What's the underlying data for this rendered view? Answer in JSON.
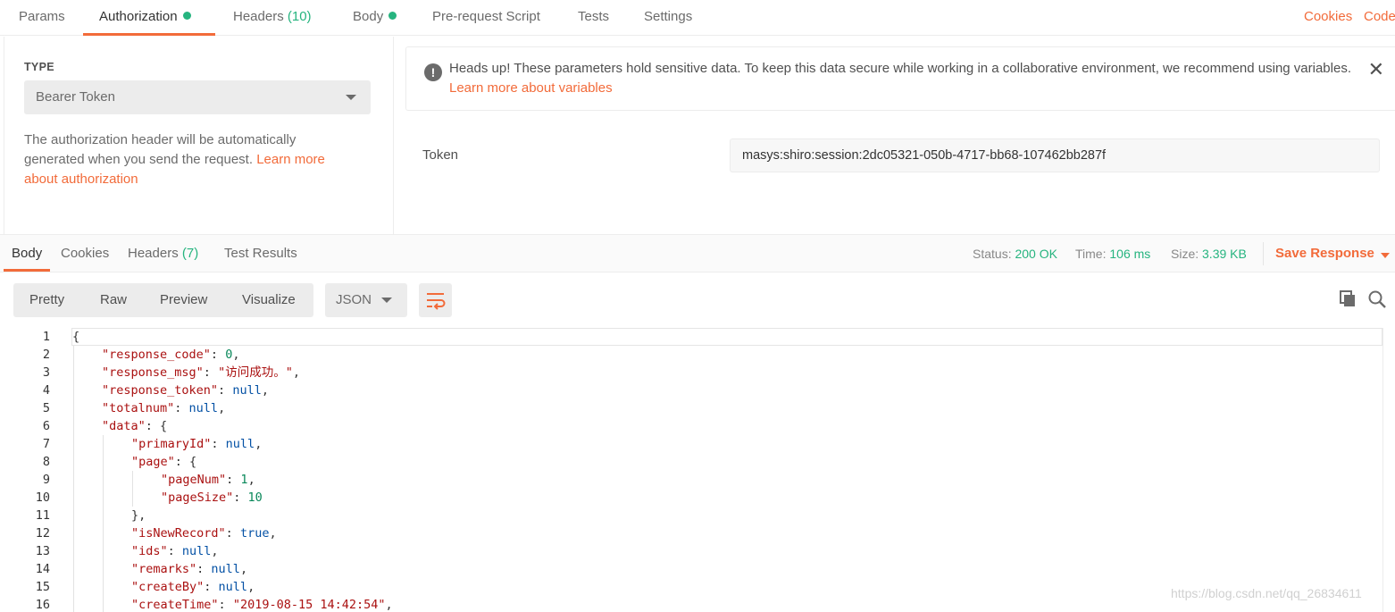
{
  "request_tabs": [
    {
      "label": "Params"
    },
    {
      "label": "Authorization"
    },
    {
      "label": "Headers",
      "count": "(10)"
    },
    {
      "label": "Body"
    },
    {
      "label": "Pre-request Script"
    },
    {
      "label": "Tests"
    },
    {
      "label": "Settings"
    }
  ],
  "right_links": {
    "cookies": "Cookies",
    "code": "Code"
  },
  "auth": {
    "type_label": "TYPE",
    "type_value": "Bearer Token",
    "desc": "The authorization header will be automatically generated when you send the request. ",
    "desc_link": "Learn more about authorization"
  },
  "alert": {
    "text": "Heads up! These parameters hold sensitive data. To keep this data secure while working in a collaborative environment, we recommend using variables. ",
    "link": "Learn more about variables",
    "close": "✕",
    "icon": "!"
  },
  "token": {
    "label": "Token",
    "value": "masys:shiro:session:2dc05321-050b-4717-bb68-107462bb287f"
  },
  "response_tabs": [
    {
      "label": "Body"
    },
    {
      "label": "Cookies"
    },
    {
      "label": "Headers",
      "count": "(7)"
    },
    {
      "label": "Test Results"
    }
  ],
  "status": {
    "status_label": "Status:",
    "status_value": "200 OK",
    "time_label": "Time:",
    "time_value": "106 ms",
    "size_label": "Size:",
    "size_value": "3.39 KB",
    "save_label": "Save Response"
  },
  "view_modes": [
    "Pretty",
    "Raw",
    "Preview",
    "Visualize"
  ],
  "format": "JSON",
  "code_lines": [
    {
      "n": "1",
      "indent": 0,
      "parts": [
        [
          "p",
          "{"
        ]
      ]
    },
    {
      "n": "2",
      "indent": 1,
      "parts": [
        [
          "k",
          "\"response_code\""
        ],
        [
          "p",
          ": "
        ],
        [
          "n",
          "0"
        ],
        [
          "p",
          ","
        ]
      ]
    },
    {
      "n": "3",
      "indent": 1,
      "parts": [
        [
          "k",
          "\"response_msg\""
        ],
        [
          "p",
          ": "
        ],
        [
          "s",
          "\"访问成功。\""
        ],
        [
          "p",
          ","
        ]
      ]
    },
    {
      "n": "4",
      "indent": 1,
      "parts": [
        [
          "k",
          "\"response_token\""
        ],
        [
          "p",
          ": "
        ],
        [
          "kw",
          "null"
        ],
        [
          "p",
          ","
        ]
      ]
    },
    {
      "n": "5",
      "indent": 1,
      "parts": [
        [
          "k",
          "\"totalnum\""
        ],
        [
          "p",
          ": "
        ],
        [
          "kw",
          "null"
        ],
        [
          "p",
          ","
        ]
      ]
    },
    {
      "n": "6",
      "indent": 1,
      "parts": [
        [
          "k",
          "\"data\""
        ],
        [
          "p",
          ": {"
        ]
      ]
    },
    {
      "n": "7",
      "indent": 2,
      "parts": [
        [
          "k",
          "\"primaryId\""
        ],
        [
          "p",
          ": "
        ],
        [
          "kw",
          "null"
        ],
        [
          "p",
          ","
        ]
      ]
    },
    {
      "n": "8",
      "indent": 2,
      "parts": [
        [
          "k",
          "\"page\""
        ],
        [
          "p",
          ": {"
        ]
      ]
    },
    {
      "n": "9",
      "indent": 3,
      "parts": [
        [
          "k",
          "\"pageNum\""
        ],
        [
          "p",
          ": "
        ],
        [
          "n",
          "1"
        ],
        [
          "p",
          ","
        ]
      ]
    },
    {
      "n": "10",
      "indent": 3,
      "parts": [
        [
          "k",
          "\"pageSize\""
        ],
        [
          "p",
          ": "
        ],
        [
          "n",
          "10"
        ]
      ]
    },
    {
      "n": "11",
      "indent": 2,
      "parts": [
        [
          "p",
          "},"
        ]
      ]
    },
    {
      "n": "12",
      "indent": 2,
      "parts": [
        [
          "k",
          "\"isNewRecord\""
        ],
        [
          "p",
          ": "
        ],
        [
          "kw",
          "true"
        ],
        [
          "p",
          ","
        ]
      ]
    },
    {
      "n": "13",
      "indent": 2,
      "parts": [
        [
          "k",
          "\"ids\""
        ],
        [
          "p",
          ": "
        ],
        [
          "kw",
          "null"
        ],
        [
          "p",
          ","
        ]
      ]
    },
    {
      "n": "14",
      "indent": 2,
      "parts": [
        [
          "k",
          "\"remarks\""
        ],
        [
          "p",
          ": "
        ],
        [
          "kw",
          "null"
        ],
        [
          "p",
          ","
        ]
      ]
    },
    {
      "n": "15",
      "indent": 2,
      "parts": [
        [
          "k",
          "\"createBy\""
        ],
        [
          "p",
          ": "
        ],
        [
          "kw",
          "null"
        ],
        [
          "p",
          ","
        ]
      ]
    },
    {
      "n": "16",
      "indent": 2,
      "parts": [
        [
          "k",
          "\"createTime\""
        ],
        [
          "p",
          ": "
        ],
        [
          "s",
          "\"2019-08-15 14:42:54\""
        ],
        [
          "p",
          ","
        ]
      ]
    }
  ],
  "watermark": "https://blog.csdn.net/qq_26834611"
}
